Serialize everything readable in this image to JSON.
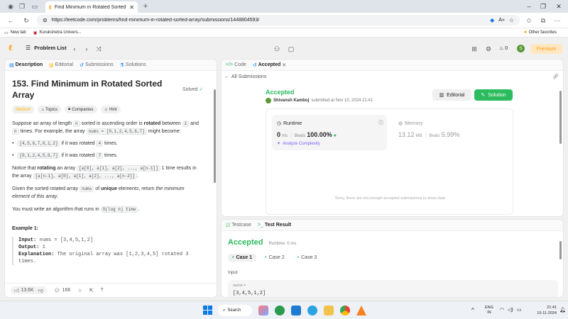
{
  "browser": {
    "tab_title": "Find Minimum in Rotated Sorted",
    "url": "https://leetcode.com/problems/find-minimum-in-rotated-sorted-array/submissions/1448804593/",
    "bookmarks": [
      "New tab",
      "Kurukshetra Univers..."
    ],
    "other_favorites": "Other favorites"
  },
  "nav": {
    "problem_list": "Problem List",
    "premium": "Premium",
    "fire_count": "0",
    "avatar_letter": "S"
  },
  "left": {
    "tabs": [
      "Description",
      "Editorial",
      "Submissions",
      "Solutions"
    ],
    "title_line1": "153. Find Minimum in Rotated Sorted",
    "title_line2": "Array",
    "solved": "Solved",
    "difficulty": "Medium",
    "tags": [
      "Topics",
      "Companies",
      "Hint"
    ],
    "p1_a": "Suppose an array of length ",
    "p1_n": "n",
    "p1_b": " sorted in ascending order is ",
    "p1_rot": "rotated",
    "p1_c": " between ",
    "p1_one": "1",
    "p1_d": " and",
    "p1_n2": "n",
    "p1_e": " times. For example, the array ",
    "p1_code": "nums = [0,1,2,4,5,6,7]",
    "p1_f": " might become:",
    "bullet1_code": "[4,5,6,7,0,1,2]",
    "bullet1_text": " if it was rotated ",
    "bullet1_num": "4",
    "bullet1_end": " times.",
    "bullet2_code": "[0,1,2,4,5,6,7]",
    "bullet2_text": " if it was rotated ",
    "bullet2_num": "7",
    "bullet2_end": " times.",
    "p2_a": "Notice that ",
    "p2_b": "rotating",
    "p2_c": " an array ",
    "p2_code1": "[a[0], a[1], a[2], ..., a[n-1]]",
    "p2_d": " 1 time results in",
    "p2_e": "the array ",
    "p2_code2": "[a[n-1], a[0], a[1], a[2], ..., a[n-2]]",
    "p2_f": ".",
    "p3_a": "Given the sorted rotated array ",
    "p3_code": "nums",
    "p3_b": " of ",
    "p3_c": "unique",
    "p3_d": " elements, return ",
    "p3_e": "the minimum",
    "p3_f": "element of this array",
    "p3_g": ".",
    "p4_a": "You must write an algorithm that runs in ",
    "p4_code": "O(log n) time",
    "p4_b": ".",
    "example_title": "Example 1:",
    "ex_input_k": "Input:",
    "ex_input_v": " nums = [3,4,5,1,2]",
    "ex_output_k": "Output:",
    "ex_output_v": " 1",
    "ex_expl_k": "Explanation:",
    "ex_expl_v": " The original array was [1,2,3,4,5] rotated 3",
    "ex_expl_v2": "times.",
    "likes": "13.6K",
    "comments": "166"
  },
  "right": {
    "tabs": [
      "Code",
      "Accepted"
    ],
    "all_submissions": "All Submissions",
    "status": "Accepted",
    "user": "Shivansh Kamboj",
    "submitted": " submitted at Nov 10, 2024 21:41",
    "editorial_btn": "Editorial",
    "solution_btn": "Solution",
    "runtime_label": "Runtime",
    "runtime_val": "0",
    "runtime_unit": " ms",
    "beats_label": "Beats",
    "runtime_beats": "100.00%",
    "analyze": "Analyze Complexity",
    "memory_label": "Memory",
    "memory_val": "13.12",
    "memory_unit": " MB",
    "memory_beats": "5.99%",
    "not_enough": "Sorry, there are not enough accepted submissions to show data"
  },
  "bottom": {
    "tabs": [
      "Testcase",
      "Test Result"
    ],
    "status": "Accepted",
    "runtime": "Runtime: 0 ms",
    "cases": [
      "Case 1",
      "Case 2",
      "Case 3"
    ],
    "input_label": "Input",
    "param_name": "nums =",
    "param_val": "[3,4,5,1,2]"
  },
  "taskbar": {
    "search": "Search",
    "lang1": "ENG",
    "lang2": "IN",
    "time": "21:41",
    "date": "10-11-2024"
  },
  "colors": {
    "accepted": "#2cbb5d",
    "medium": "#ffb800",
    "premium": "#ffa116",
    "link": "#007aff"
  }
}
